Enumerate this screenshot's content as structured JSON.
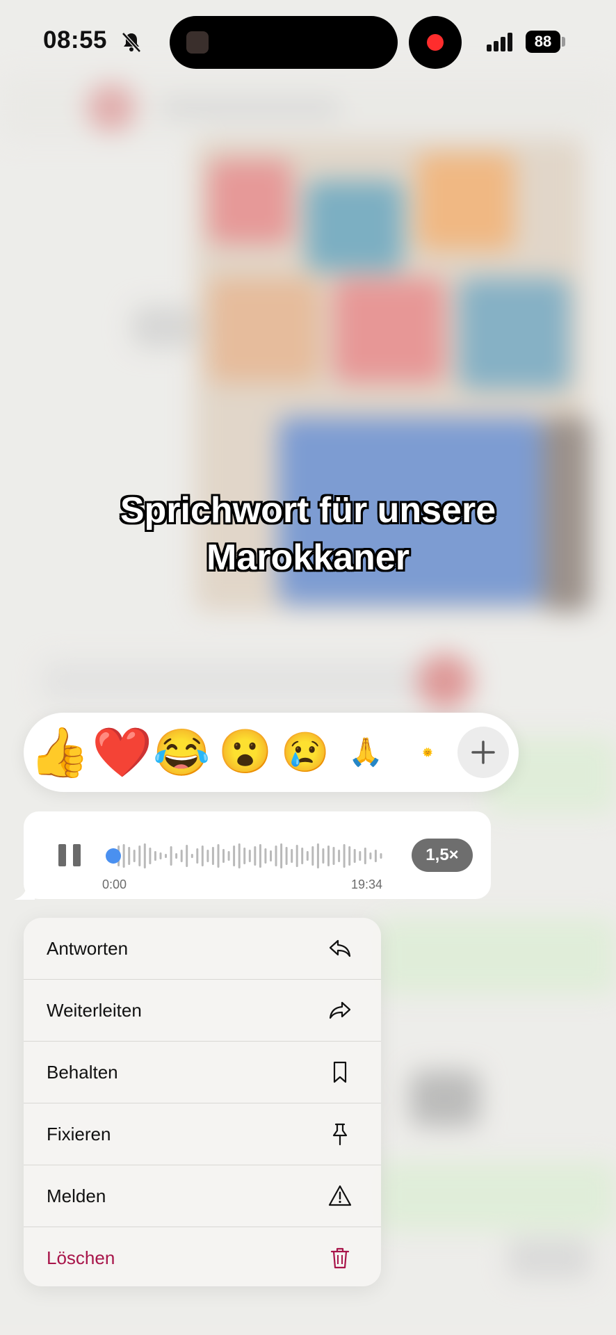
{
  "status_bar": {
    "time": "08:55",
    "battery": "88",
    "icons": [
      "bell-muted-icon",
      "recording-indicator",
      "signal-icon",
      "battery-icon"
    ]
  },
  "caption": {
    "line1": "Sprichwort für unsere",
    "line2": "Marokkaner"
  },
  "reactions": {
    "emojis": [
      "👍",
      "❤️",
      "😂",
      "😮",
      "😢",
      "🙏",
      "🌞"
    ],
    "more_icon": "plus-icon"
  },
  "voice_message": {
    "start_time": "0:00",
    "duration": "19:34",
    "speed": "1,5×",
    "progress": 0.0,
    "state": "playing"
  },
  "menu": {
    "items": [
      {
        "label": "Antworten",
        "icon": "reply-icon"
      },
      {
        "label": "Weiterleiten",
        "icon": "forward-icon"
      },
      {
        "label": "Behalten",
        "icon": "bookmark-icon"
      },
      {
        "label": "Fixieren",
        "icon": "pin-icon"
      },
      {
        "label": "Melden",
        "icon": "warning-icon"
      },
      {
        "label": "Löschen",
        "icon": "trash-icon",
        "color": "#a8154a"
      }
    ]
  },
  "colors": {
    "accent": "#4a90f0",
    "danger": "#a8154a",
    "record": "#ff2d2d"
  }
}
